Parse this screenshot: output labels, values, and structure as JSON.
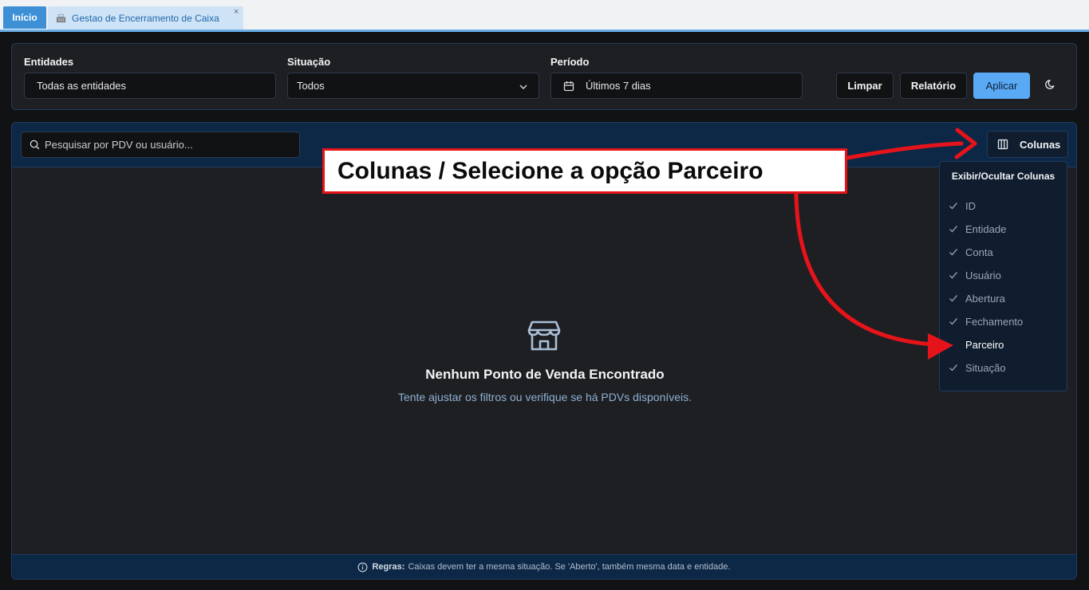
{
  "tabs": {
    "home": "Início",
    "active": "Gestao de Encerramento de Caixa",
    "close": "×"
  },
  "filters": {
    "entidades_label": "Entidades",
    "entidades_value": "Todas as entidades",
    "situacao_label": "Situação",
    "situacao_value": "Todos",
    "periodo_label": "Período",
    "periodo_value": "Últimos 7 dias",
    "limpar": "Limpar",
    "relatorio": "Relatório",
    "aplicar": "Aplicar"
  },
  "search": {
    "placeholder": "Pesquisar por PDV ou usuário..."
  },
  "columns": {
    "button": "Colunas",
    "menu_title": "Exibir/Ocultar Colunas",
    "items": [
      {
        "label": "ID",
        "checked": true
      },
      {
        "label": "Entidade",
        "checked": true
      },
      {
        "label": "Conta",
        "checked": true
      },
      {
        "label": "Usuário",
        "checked": true
      },
      {
        "label": "Abertura",
        "checked": true
      },
      {
        "label": "Fechamento",
        "checked": true
      },
      {
        "label": "Parceiro",
        "checked": false
      },
      {
        "label": "Situação",
        "checked": true
      }
    ]
  },
  "empty": {
    "title": "Nenhum Ponto de Venda Encontrado",
    "subtitle": "Tente ajustar os filtros ou verifique se há PDVs disponíveis."
  },
  "footer": {
    "label": "Regras:",
    "text": "Caixas devem ter a mesma situação. Se 'Aberto', também mesma data e entidade."
  },
  "callout": {
    "text": "Colunas / Selecione a opção Parceiro"
  },
  "colors": {
    "accent": "#5aa9f5",
    "annotation": "#e6141a"
  }
}
